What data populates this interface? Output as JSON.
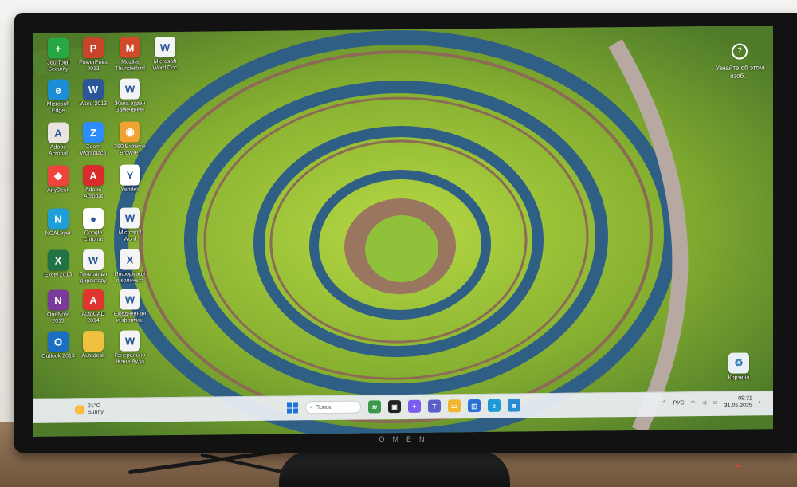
{
  "monitor": {
    "brand": "OMEN"
  },
  "desktop": {
    "icons": [
      {
        "label": "360 Total\nSecurity",
        "icon": "360-total-security-icon",
        "color": "#27a844",
        "glyph": "+"
      },
      {
        "label": "PowerPoint\n2013",
        "icon": "powerpoint-icon",
        "color": "#c8442a",
        "glyph": "P"
      },
      {
        "label": "Mozilla\nThunderbird",
        "icon": "thunderbird-icon",
        "color": "#d24a2a",
        "glyph": "M"
      },
      {
        "label": "Microsoft\nWord Doc",
        "icon": "word-document-icon",
        "color": "#f4f4f4",
        "glyph": "W"
      },
      {
        "label": "Microsoft\nEdge",
        "icon": "edge-icon",
        "color": "#1b8fd6",
        "glyph": "e"
      },
      {
        "label": "Word 2013",
        "icon": "word-icon",
        "color": "#2b579a",
        "glyph": "W"
      },
      {
        "label": "Жана аудан\nЗамечания",
        "icon": "word-document-icon",
        "color": "#f4f4f4",
        "glyph": "W"
      },
      {
        "label": "Adobe\nAcrobat",
        "icon": "adobe-acrobat-icon",
        "color": "#e9e4df",
        "glyph": "A"
      },
      {
        "label": "Zoom\nWorkplace",
        "icon": "zoom-icon",
        "color": "#2d8cff",
        "glyph": "Z"
      },
      {
        "label": "360 Extreme\nBrowser",
        "icon": "360-extreme-browser-icon",
        "color": "#f1a233",
        "glyph": "◉"
      },
      {
        "label": "AnyDesk",
        "icon": "anydesk-icon",
        "color": "#ef443b",
        "glyph": "◆"
      },
      {
        "label": "Adobe\nAcrobat",
        "icon": "adobe-acrobat-icon",
        "color": "#d92b2b",
        "glyph": "A"
      },
      {
        "label": "Yandex",
        "icon": "yandex-icon",
        "color": "#ffffff",
        "glyph": "Y"
      },
      {
        "label": "NCALayer",
        "icon": "ncalayer-icon",
        "color": "#1e9fd8",
        "glyph": "N"
      },
      {
        "label": "Google\nChrome",
        "icon": "chrome-icon",
        "color": "#ffffff",
        "glyph": "●"
      },
      {
        "label": "Microsoft\nWord",
        "icon": "word-document-icon",
        "color": "#f4f4f4",
        "glyph": "W"
      },
      {
        "label": "Excel 2013",
        "icon": "excel-icon",
        "color": "#217346",
        "glyph": "X"
      },
      {
        "label": "Генеральн\nдиректору",
        "icon": "word-document-icon",
        "color": "#f4f4f4",
        "glyph": "W"
      },
      {
        "label": "Информаци\nо количест",
        "icon": "excel-document-icon",
        "color": "#f4f4f4",
        "glyph": "X"
      },
      {
        "label": "OneNote\n2013",
        "icon": "onenote-icon",
        "color": "#7a3a9a",
        "glyph": "N"
      },
      {
        "label": "AutoCAD\n2014",
        "icon": "autocad-icon",
        "color": "#e0342f",
        "glyph": "A"
      },
      {
        "label": "Ежедневная\nинформац",
        "icon": "word-document-icon",
        "color": "#f4f4f4",
        "glyph": "W"
      },
      {
        "label": "Outlook 2013",
        "icon": "outlook-icon",
        "color": "#1a6fc2",
        "glyph": "O"
      },
      {
        "label": "Autodesk",
        "icon": "folder-icon",
        "color": "#f0c040",
        "glyph": ""
      },
      {
        "label": "Генерально\nЖана Ауда",
        "icon": "word-document-icon",
        "color": "#f4f4f4",
        "glyph": "W"
      }
    ],
    "recycle_bin": {
      "label": "Корзина",
      "icon": "recycle-bin-icon"
    },
    "learn_more": {
      "text": "Узнайте об\nэтом изоб...",
      "icon": "learn-more-icon"
    }
  },
  "taskbar": {
    "weather": {
      "temp": "21°C",
      "condition": "Sunny",
      "icon": "sun-icon"
    },
    "search_placeholder": "Поиск",
    "pinned": [
      {
        "icon": "widgets-icon",
        "color": "#3a9a4a",
        "glyph": "≋"
      },
      {
        "icon": "task-view-icon",
        "color": "#222222",
        "glyph": "▣"
      },
      {
        "icon": "copilot-icon",
        "color": "#7a5cf0",
        "glyph": "✦"
      },
      {
        "icon": "teams-icon",
        "color": "#5b5fc7",
        "glyph": "T"
      },
      {
        "icon": "file-explorer-icon",
        "color": "#f0b732",
        "glyph": "▭"
      },
      {
        "icon": "store-icon",
        "color": "#2b6fd6",
        "glyph": "◫"
      },
      {
        "icon": "edge-icon",
        "color": "#1b9ad6",
        "glyph": "e"
      },
      {
        "icon": "app-icon",
        "color": "#2a8bd0",
        "glyph": "◙"
      }
    ],
    "tray": {
      "language": "РУС",
      "time": "09:31",
      "date": "31.05.2025"
    }
  }
}
